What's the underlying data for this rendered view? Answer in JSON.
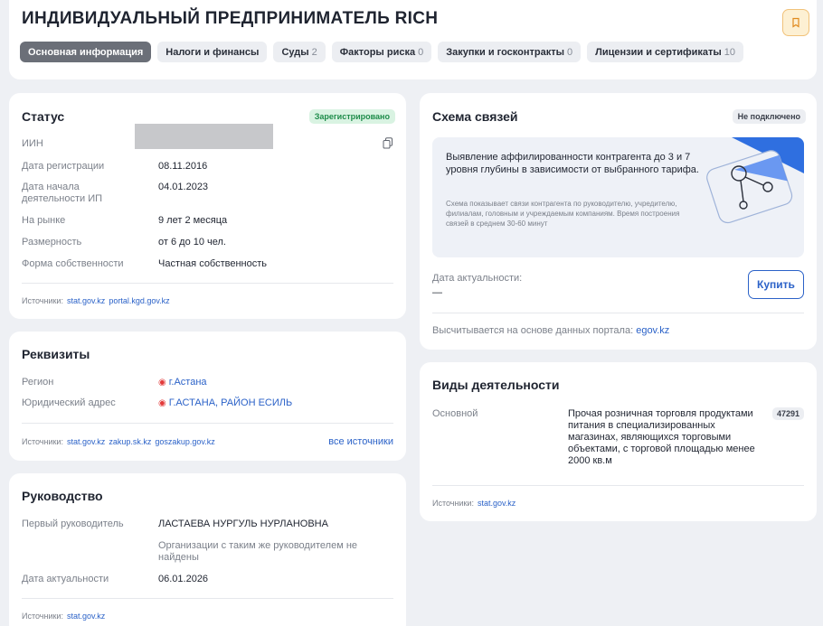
{
  "header": {
    "title": "ИНДИВИДУАЛЬНЫЙ ПРЕДПРИНИМАТЕЛЬ RICH",
    "tabs": [
      {
        "label": "Основная информация",
        "count": ""
      },
      {
        "label": "Налоги и финансы",
        "count": ""
      },
      {
        "label": "Суды",
        "count": "2"
      },
      {
        "label": "Факторы риска",
        "count": "0"
      },
      {
        "label": "Закупки и госконтракты",
        "count": "0"
      },
      {
        "label": "Лицензии и сертификаты",
        "count": "10"
      }
    ]
  },
  "status": {
    "title": "Статус",
    "badge": "Зарегистрировано",
    "rows": [
      {
        "label": "ИИН",
        "value": ""
      },
      {
        "label": "Дата регистрации",
        "value": "08.11.2016"
      },
      {
        "label": "Дата начала деятельности ИП",
        "value": "04.01.2023"
      },
      {
        "label": "На рынке",
        "value": "9 лет 2 месяца"
      },
      {
        "label": "Размерность",
        "value": "от 6 до 10 чел."
      },
      {
        "label": "Форма собственности",
        "value": "Частная собственность"
      }
    ],
    "sources_label": "Источники:",
    "sources": [
      "stat.gov.kz",
      "portal.kgd.gov.kz"
    ]
  },
  "requisites": {
    "title": "Реквизиты",
    "rows": [
      {
        "label": "Регион",
        "value": "г.Астана"
      },
      {
        "label": "Юридический адрес",
        "value": "Г.АСТАНА, РАЙОН ЕСИЛЬ"
      }
    ],
    "sources_label": "Источники:",
    "sources": [
      "stat.gov.kz",
      "zakup.sk.kz",
      "goszakup.gov.kz"
    ],
    "all_sources": "все источники"
  },
  "management": {
    "title": "Руководство",
    "rows": [
      {
        "label": "Первый руководитель",
        "value": "ЛАСТАЕВА НУРГУЛЬ НУРЛАНОВНА",
        "note": "Организации с таким же руководителем не найдены"
      },
      {
        "label": "Дата актуальности",
        "value": "06.01.2026"
      }
    ],
    "sources_label": "Источники:",
    "sources": [
      "stat.gov.kz"
    ]
  },
  "links": {
    "title": "Схема связей",
    "badge": "Не подключено",
    "promo_main": "Выявление аффилированности контрагента до 3 и 7 уровня глубины в зависимости от выбранного тарифа.",
    "promo_sub": "Схема показывает связи контрагента по руководителю, учредителю, филиалам, головным и учреждаемым компаниям. Время построения связей в среднем 30-60 минут",
    "date_label": "Дата актуальности:",
    "date_value": "—",
    "buy": "Купить",
    "calc_note": "Высчитывается на основе данных портала:",
    "calc_source": "egov.kz"
  },
  "activities": {
    "title": "Виды деятельности",
    "label": "Основной",
    "description": "Прочая розничная торговля продуктами питания в специализированных магазинах, являющихся торговыми объектами, с торговой площадью менее 2000 кв.м",
    "code": "47291",
    "sources_label": "Источники:",
    "sources": [
      "stat.gov.kz"
    ]
  },
  "colors": {
    "accent": "#2b62c8",
    "registered_bg": "#d9f3e2",
    "registered_text": "#1e8c4a"
  }
}
